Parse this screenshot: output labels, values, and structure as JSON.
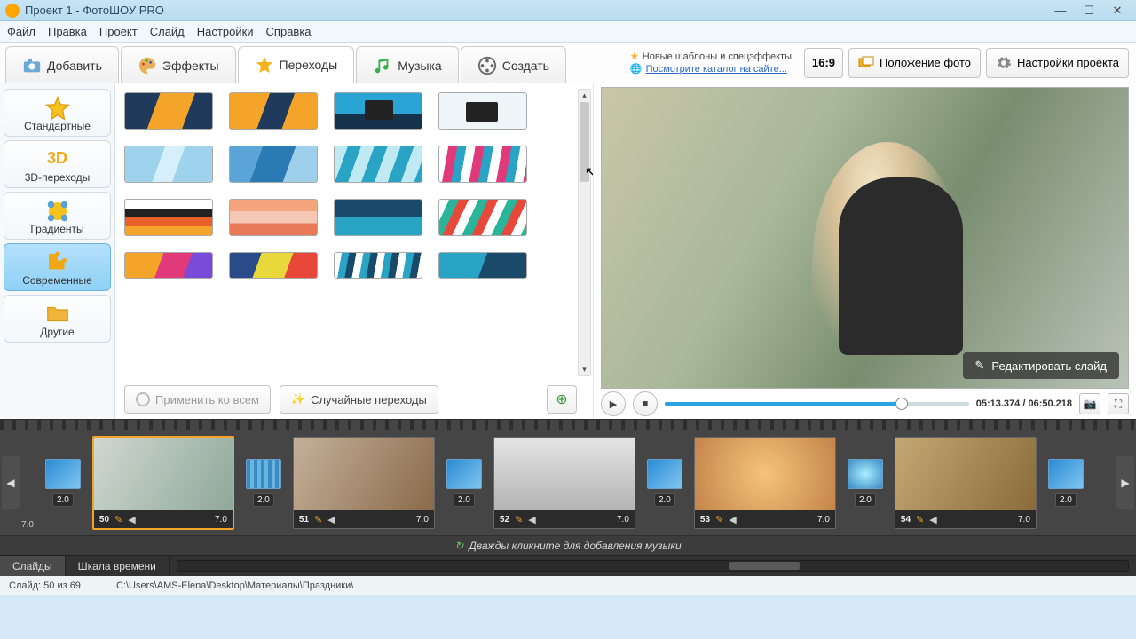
{
  "window": {
    "title": "Проект 1 - ФотоШОУ PRO"
  },
  "menu": [
    "Файл",
    "Правка",
    "Проект",
    "Слайд",
    "Настройки",
    "Справка"
  ],
  "main_tabs": {
    "add": "Добавить",
    "effects": "Эффекты",
    "transitions": "Переходы",
    "music": "Музыка",
    "create": "Создать"
  },
  "promo": {
    "line1": "Новые шаблоны и спецэффекты",
    "line2": "Посмотрите каталог на сайте..."
  },
  "aspect": "16:9",
  "top_buttons": {
    "layout": "Положение фото",
    "settings": "Настройки проекта"
  },
  "categories": {
    "standard": "Стандартные",
    "three_d": "3D-переходы",
    "gradients": "Градиенты",
    "modern": "Современные",
    "other": "Другие"
  },
  "apply_all": "Применить ко всем",
  "random": "Случайные переходы",
  "edit_slide": "Редактировать слайд",
  "time": {
    "cur": "05:13.374",
    "sep": " / ",
    "total": "06:50.218"
  },
  "slides": [
    {
      "num": "50",
      "dur": "7.0"
    },
    {
      "num": "51",
      "dur": "7.0"
    },
    {
      "num": "52",
      "dur": "7.0"
    },
    {
      "num": "53",
      "dur": "7.0"
    },
    {
      "num": "54",
      "dur": "7.0"
    }
  ],
  "trans_dur": "2.0",
  "left_edge_dur": "7.0",
  "right_edge_dur": "2.0",
  "music_hint": "Дважды кликните для добавления музыки",
  "tl_tabs": {
    "slides": "Слайды",
    "timescale": "Шкала времени"
  },
  "status": {
    "slide": "Слайд: 50 из 69",
    "path": "C:\\Users\\AMS-Elena\\Desktop\\Материалы\\Праздники\\"
  }
}
